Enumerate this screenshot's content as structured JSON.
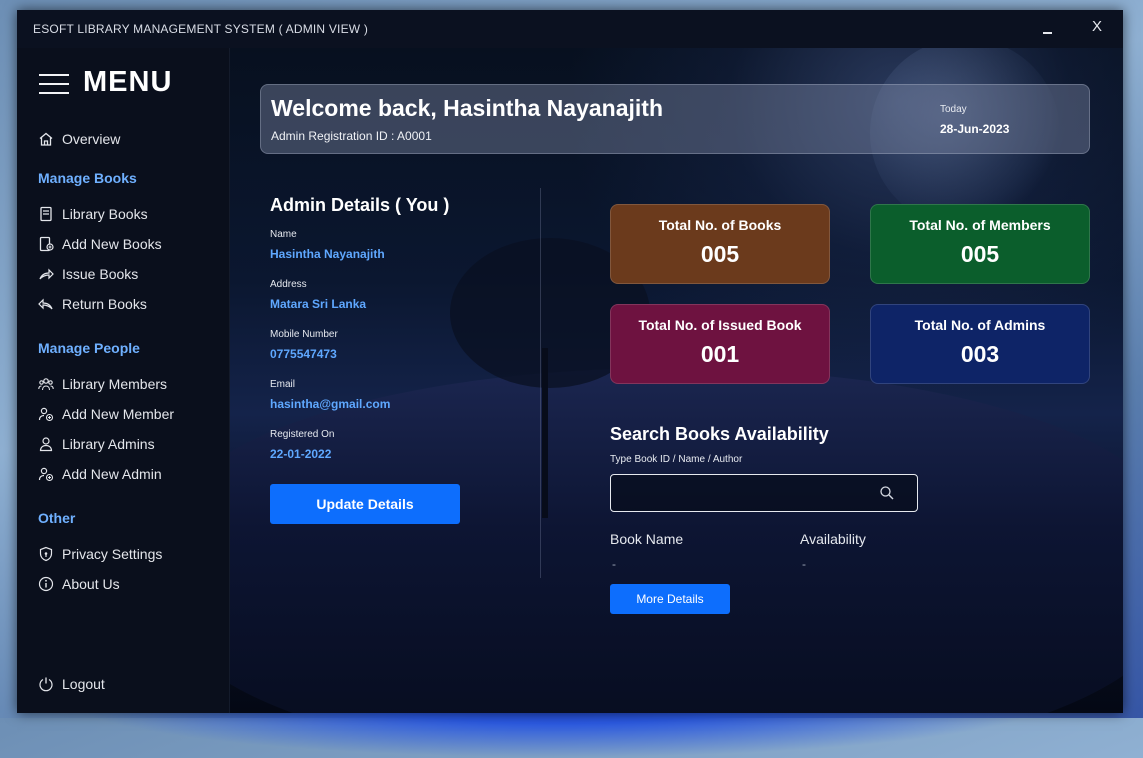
{
  "window": {
    "title": "ESOFT LIBRARY MANAGEMENT SYSTEM ( ADMIN VIEW )",
    "close_label": "X"
  },
  "sidebar": {
    "menu_title": "MENU",
    "overview": "Overview",
    "sections": {
      "manage_books": "Manage Books",
      "manage_people": "Manage People",
      "other": "Other"
    },
    "items": {
      "library_books": "Library Books",
      "add_new_books": "Add New Books",
      "issue_books": "Issue Books",
      "return_books": "Return Books",
      "library_members": "Library Members",
      "add_new_member": "Add New Member",
      "library_admins": "Library Admins",
      "add_new_admin": "Add New Admin",
      "privacy_settings": "Privacy Settings",
      "about_us": "About Us"
    },
    "logout": "Logout"
  },
  "welcome": {
    "title": "Welcome back, Hasintha Nayanajith",
    "subtitle": "Admin Registration ID : A0001",
    "today_label": "Today",
    "today_date": "28-Jun-2023"
  },
  "admin_details": {
    "title": "Admin Details ( You )",
    "fields": [
      {
        "label": "Name",
        "value": "Hasintha Nayanajith"
      },
      {
        "label": "Address",
        "value": "Matara Sri Lanka"
      },
      {
        "label": "Mobile Number",
        "value": "0775547473"
      },
      {
        "label": "Email",
        "value": "hasintha@gmail.com"
      },
      {
        "label": "Registered On",
        "value": "22-01-2022"
      }
    ],
    "update_button": "Update Details"
  },
  "stats": [
    {
      "label": "Total No. of Books",
      "value": "005",
      "color": "#6b3a1c"
    },
    {
      "label": "Total No. of Members",
      "value": "005",
      "color": "#0b5e2c"
    },
    {
      "label": "Total No. of Issued Book",
      "value": "001",
      "color": "#6e1240"
    },
    {
      "label": "Total No. of Admins",
      "value": "003",
      "color": "#0e2467"
    }
  ],
  "search": {
    "title": "Search Books Availability",
    "hint": "Type Book ID / Name / Author",
    "placeholder": "",
    "col_book_name": "Book Name",
    "col_availability": "Availability",
    "book_name_value": "-",
    "availability_value": "-",
    "more_button": "More Details"
  },
  "colors": {
    "accent": "#0d6efd",
    "section_heading": "#6fb0ff",
    "detail_value": "#5fa8ff"
  }
}
